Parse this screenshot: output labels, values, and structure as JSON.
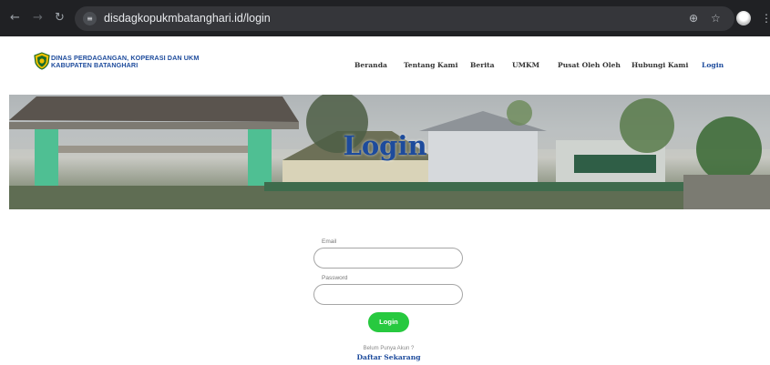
{
  "browser": {
    "url": "disdagkopukmbatanghari.id/login",
    "icons": {
      "back": "arrow-left-icon",
      "forward": "arrow-right-icon",
      "reload": "reload-icon",
      "site_info": "tune-icon",
      "zoom": "zoom-icon",
      "bookmark": "star-icon",
      "profile": "avatar-icon",
      "menu": "kebab-menu-icon"
    }
  },
  "site": {
    "logo_line1": "DINAS PERDAGANGAN, KOPERASI DAN UKM",
    "logo_line2": "KABUPATEN BATANGHARI",
    "nav": [
      {
        "label": "Beranda"
      },
      {
        "label": "Tentang Kami"
      },
      {
        "label": "Berita"
      },
      {
        "label": "UMKM"
      },
      {
        "label": "Pusat Oleh Oleh"
      },
      {
        "label": "Hubungi Kami"
      },
      {
        "label": "Login",
        "active": true
      }
    ],
    "hero_title": "Login"
  },
  "form": {
    "email_label": "Email",
    "email_value": "",
    "password_label": "Password",
    "password_value": "",
    "submit_label": "Login",
    "register_hint": "Belum Punya Akun ?",
    "register_link": "Daftar Sekarang"
  },
  "colors": {
    "brand_blue": "#1d4b9c",
    "login_green": "#27c93f",
    "chrome_dark": "#202124"
  }
}
